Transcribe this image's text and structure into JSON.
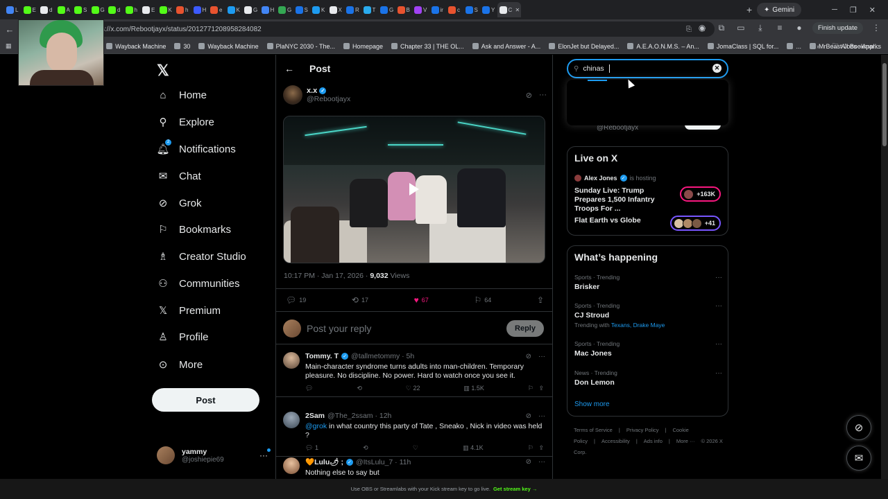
{
  "browser": {
    "tab_favicon_colors": [
      "#4285f4",
      "#53fc18",
      "#e8eaed",
      "#53fc18",
      "#53fc18",
      "#53fc18",
      "#53fc18",
      "#53fc18",
      "#e8eaed",
      "#53fc18",
      "#e8532f",
      "#3c5afe",
      "#e8532f",
      "#1d9bf0",
      "#e8eaed",
      "#4285f4",
      "#34a853",
      "#1a73e8",
      "#1d9bf0",
      "#e8eaed",
      "#1a73e8",
      "#2aabee",
      "#1a73e8",
      "#e8532f",
      "#a142f4",
      "#1a73e8",
      "#e8532f",
      "#1a73e8",
      "#1a73e8",
      "#e8eaed"
    ],
    "tab_letters": [
      "L",
      "E",
      "d",
      "A",
      "S",
      "G",
      "d",
      "h",
      "E",
      "K",
      "h",
      "H",
      "e",
      "K",
      "G",
      "H",
      "G",
      "S",
      "K",
      "X",
      "R",
      "T",
      "G",
      "B",
      "V",
      "ir",
      "c",
      "S",
      "Y",
      "C"
    ],
    "new_tab": "+",
    "gemini_label": "Gemini",
    "url": "s://x.com/Rebootjayx/status/2012771208958284082",
    "finish_update": "Finish update",
    "bookmarks": [
      "Wayback Machine",
      "30",
      "Wayback Machine",
      "PlaNYC 2030 - The...",
      "Homepage",
      "Chapter 33 | THE OL...",
      "Ask and Answer - A...",
      "ElonJet but Delayed...",
      "A.E.A.O.N.M.S. – An...",
      "JomaClass | SQL for...",
      "...",
      "MrBeast Jobs - Appl..."
    ],
    "all_bookmarks": "All Bookmarks"
  },
  "nav": {
    "items": [
      {
        "label": "Home",
        "icon": "home-icon"
      },
      {
        "label": "Explore",
        "icon": "search-icon"
      },
      {
        "label": "Notifications",
        "icon": "bell-icon",
        "badge": "2"
      },
      {
        "label": "Chat",
        "icon": "mail-icon"
      },
      {
        "label": "Grok",
        "icon": "grok-icon"
      },
      {
        "label": "Bookmarks",
        "icon": "bookmark-icon"
      },
      {
        "label": "Creator Studio",
        "icon": "creator-icon"
      },
      {
        "label": "Communities",
        "icon": "communities-icon"
      },
      {
        "label": "Premium",
        "icon": "x-icon"
      },
      {
        "label": "Profile",
        "icon": "person-icon"
      },
      {
        "label": "More",
        "icon": "more-icon"
      }
    ],
    "post_button": "Post",
    "account": {
      "name": "yammy",
      "handle": "@joshiepie69"
    }
  },
  "post": {
    "header_title": "Post",
    "author_name": "x.x",
    "author_handle": "@Rebootjayx",
    "time": "10:17 PM · Jan 17, 2026 · ",
    "views_count": "9,032",
    "views_label": " Views",
    "replies": "19",
    "reposts": "17",
    "likes": "67",
    "bookmarks": "64",
    "reply_placeholder": "Post your reply",
    "reply_button": "Reply"
  },
  "replies": [
    {
      "name": "Tommy. T",
      "handle": "@tallmetommy · 5h",
      "text": "Main-character syndrome turns adults into man-children. Temporary pleasure. No discipline. No power. Hard to watch once you see it.",
      "replies": "",
      "reposts": "",
      "likes": "22",
      "views": "1.5K"
    },
    {
      "name": "2Sam",
      "handle": "@The_2ssam · 12h",
      "mention": "@grok",
      "text": " in what country this party of Tate , Sneako , Nick in video was held ?",
      "replies": "1",
      "reposts": "",
      "likes": "",
      "views": "4.1K"
    },
    {
      "name": "🧡Lulu🌶 ;",
      "handle": "@ItsLulu_7 · 11h",
      "text": "Nothing else to say but"
    }
  ],
  "search": {
    "value": "chinas",
    "partial_handle": "@Rebootjayx"
  },
  "live": {
    "title": "Live on X",
    "host_name": "Alex Jones",
    "host_status": "is hosting",
    "items": [
      {
        "title": "Sunday Live: Trump Prepares 1,500 Infantry Troops For ...",
        "count": "+163K",
        "ring": "#f91880"
      },
      {
        "title": "Flat Earth vs Globe",
        "count": "+41",
        "ring": "#7856ff"
      }
    ]
  },
  "happening": {
    "title": "What’s happening",
    "trends": [
      {
        "category": "Sports · Trending",
        "title": "Brisker",
        "with_label": "",
        "with_links": ""
      },
      {
        "category": "Sports · Trending",
        "title": "CJ Stroud",
        "with_label": "Trending with ",
        "with_links": "Texans, Drake Maye"
      },
      {
        "category": "Sports · Trending",
        "title": "Mac Jones",
        "with_label": "",
        "with_links": ""
      },
      {
        "category": "News · Trending",
        "title": "Don Lemon",
        "with_label": "",
        "with_links": ""
      }
    ],
    "show_more": "Show more"
  },
  "footer": {
    "links": [
      "Terms of Service",
      "|",
      "Privacy Policy",
      "|",
      "Cookie Policy",
      "|",
      "Accessibility",
      "|",
      "Ads info",
      "|",
      "More ···",
      "© 2026 X Corp."
    ]
  },
  "statusbar": {
    "text": "Use OBS or Streamlabs with your Kick stream key to go live.",
    "cta": "Get stream key →"
  }
}
